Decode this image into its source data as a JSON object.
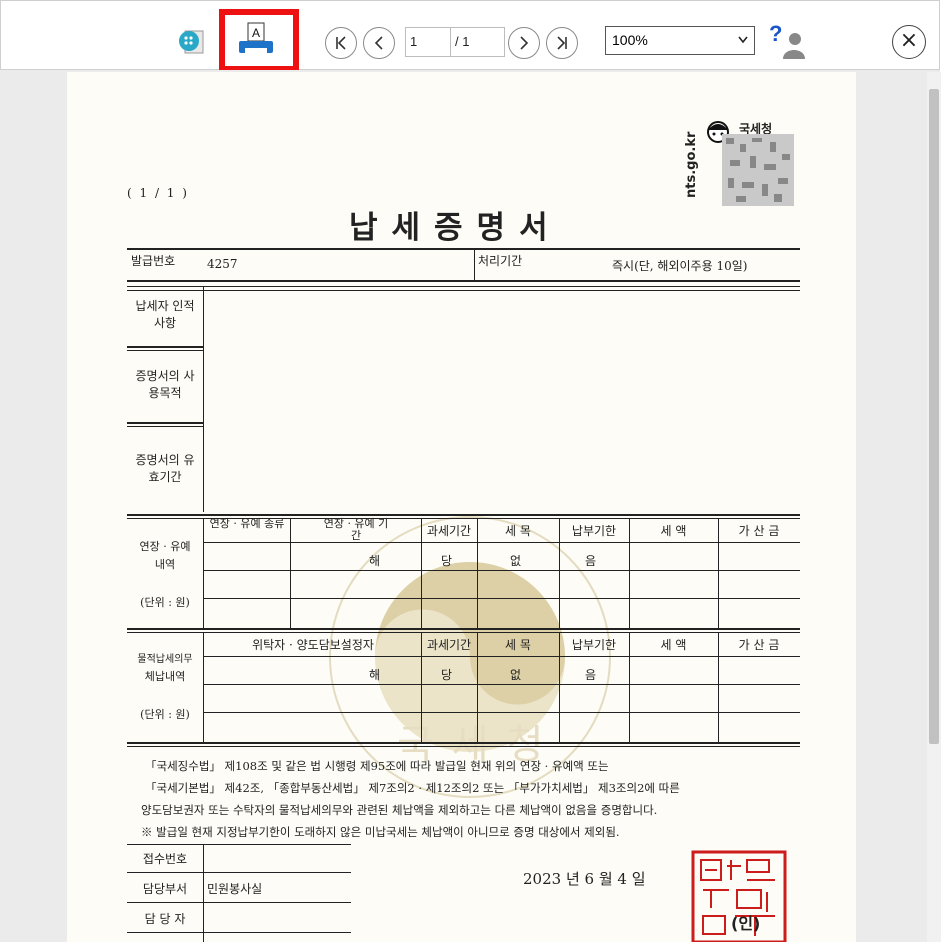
{
  "toolbar": {
    "page_current": "1",
    "page_total": "/ 1",
    "zoom": "100%",
    "close_symbol": "×",
    "help_symbol": "?"
  },
  "doc": {
    "page_indicator": "( 1 / 1 )",
    "agency_name": "국세청",
    "site": "nts.go.kr",
    "title": "납세증명서",
    "issue_no_label": "발급번호",
    "issue_no": "4257",
    "processing_label": "처리기간",
    "processing_value": "즉시(단, 해외이주용 10일)",
    "taxpayer_label": "납세자 인적사항",
    "purpose_label": "증명서의 사용목적",
    "validity_label": "증명서의 유효기간",
    "section1": {
      "label_1": "연장 · 유예",
      "label_2": "내역",
      "unit": "(단위 : 원)",
      "col_type": "연장 · 유예 종류",
      "col_period": "연장 · 유예 기 간",
      "col_tax_period": "과세기간",
      "col_item": "세 목",
      "col_due": "납부기한",
      "col_amount": "세 액",
      "col_add": "가 산 금",
      "none": [
        "해",
        "당",
        "없",
        "음"
      ]
    },
    "section2": {
      "label_1": "물적납세의무",
      "label_2": "체납내역",
      "unit": "(단위 : 원)",
      "col_trustee": "위탁자 · 양도담보설정자",
      "col_tax_period": "과세기간",
      "col_item": "세 목",
      "col_due": "납부기한",
      "col_amount": "세 액",
      "col_add": "가 산 금",
      "none": [
        "해",
        "당",
        "없",
        "음"
      ]
    },
    "statement": [
      "「국세징수법」 제108조 및 같은 법 시행령 제95조에 따라 발급일 현재 위의 연장 · 유예액 또는",
      "「국세기본법」 제42조, 「종합부동산세법」 제7조의2 · 제12조의2 또는 「부가가치세법」 제3조의2에 따른",
      "양도담보권자 또는 수탁자의 물적납세의무와 관련된 체납액을 제외하고는 다른 체납액이 없음을 증명합니다.",
      "※ 발급일 현재 지정납부기한이 도래하지 않은 미납국세는 체납액이 아니므로 증명 대상에서 제외됨."
    ],
    "receipt_no_label": "접수번호",
    "dept_label": "담당부서",
    "dept_value": "민원봉사실",
    "staff_label": "담 당 자",
    "date": "2023 년  6 월  4 일",
    "seal_text": "(인)",
    "watermark": "국세청"
  }
}
